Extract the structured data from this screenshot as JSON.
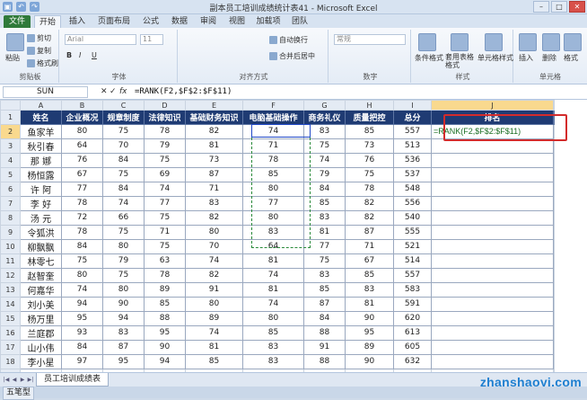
{
  "window": {
    "title": "副本员工培训成绩统计表41 - Microsoft Excel",
    "minimize": "–",
    "maximize": "□",
    "close": "✕"
  },
  "quick_access": [
    "▣",
    "↶",
    "↷"
  ],
  "tabs": [
    "文件",
    "开始",
    "插入",
    "页面布局",
    "公式",
    "数据",
    "审阅",
    "视图",
    "加载项",
    "团队"
  ],
  "active_tab": "开始",
  "ribbon": {
    "clipboard": {
      "label": "剪贴板",
      "paste": "粘贴",
      "cut": "剪切",
      "copy": "复制",
      "format_painter": "格式刷"
    },
    "font": {
      "label": "字体",
      "font_name": "Arial",
      "font_size": "11",
      "bold": "B",
      "italic": "I",
      "underline": "U"
    },
    "alignment": {
      "label": "对齐方式",
      "wrap": "自动换行",
      "merge": "合并后居中"
    },
    "number": {
      "label": "数字",
      "format": "常规"
    },
    "styles": {
      "label": "样式",
      "conditional": "条件格式",
      "table": "套用表格格式",
      "cell_styles": "单元格样式"
    },
    "cells": {
      "label": "单元格",
      "insert": "插入",
      "delete": "删除",
      "format": "格式"
    }
  },
  "formula_bar": {
    "name_box": "SUN",
    "cancel": "✕",
    "enter": "✓",
    "fx": "fx",
    "formula": "=RANK(F2,$F$2:$F$11)"
  },
  "columns": [
    "A",
    "B",
    "C",
    "D",
    "E",
    "F",
    "G",
    "H",
    "I",
    "J"
  ],
  "headers": [
    "姓名",
    "企业概况",
    "规章制度",
    "法律知识",
    "基础财务知识",
    "电脑基础操作",
    "商务礼仪",
    "质量把控",
    "总分",
    "排名"
  ],
  "rank_formula": "=RANK(F2,$F$2:$F$11)",
  "rows": [
    [
      "鱼家羊",
      "80",
      "75",
      "78",
      "82",
      "74",
      "83",
      "85",
      "557"
    ],
    [
      "秋引春",
      "64",
      "70",
      "79",
      "81",
      "71",
      "75",
      "73",
      "513"
    ],
    [
      "那 娜",
      "76",
      "84",
      "75",
      "73",
      "78",
      "74",
      "76",
      "536"
    ],
    [
      "杨恒露",
      "67",
      "75",
      "69",
      "87",
      "85",
      "79",
      "75",
      "537"
    ],
    [
      "许 阿",
      "77",
      "84",
      "74",
      "71",
      "80",
      "84",
      "78",
      "548"
    ],
    [
      "李 好",
      "78",
      "74",
      "77",
      "83",
      "77",
      "85",
      "82",
      "556"
    ],
    [
      "汤 元",
      "72",
      "66",
      "75",
      "82",
      "80",
      "83",
      "82",
      "540"
    ],
    [
      "令狐洪",
      "78",
      "75",
      "71",
      "80",
      "83",
      "81",
      "87",
      "555"
    ],
    [
      "柳飘飘",
      "84",
      "80",
      "75",
      "70",
      "64",
      "77",
      "71",
      "521"
    ],
    [
      "林零七",
      "75",
      "79",
      "63",
      "74",
      "81",
      "75",
      "67",
      "514"
    ],
    [
      "赵智奎",
      "80",
      "75",
      "78",
      "82",
      "74",
      "83",
      "85",
      "557"
    ],
    [
      "何嘉华",
      "74",
      "80",
      "89",
      "91",
      "81",
      "85",
      "83",
      "583"
    ],
    [
      "刘小美",
      "94",
      "90",
      "85",
      "80",
      "74",
      "87",
      "81",
      "591"
    ],
    [
      "杨万里",
      "95",
      "94",
      "88",
      "89",
      "80",
      "84",
      "90",
      "620"
    ],
    [
      "兰庭郡",
      "93",
      "83",
      "95",
      "74",
      "85",
      "88",
      "95",
      "613"
    ],
    [
      "山小伟",
      "84",
      "87",
      "90",
      "81",
      "83",
      "91",
      "89",
      "605"
    ],
    [
      "李小星",
      "97",
      "95",
      "94",
      "85",
      "83",
      "88",
      "90",
      "632"
    ]
  ],
  "extra_rows": [
    "19",
    "20",
    "21"
  ],
  "sheet_tab": "员工培训成绩表",
  "status_mode": "五笔型",
  "watermark": "zhanshaoyi.com"
}
